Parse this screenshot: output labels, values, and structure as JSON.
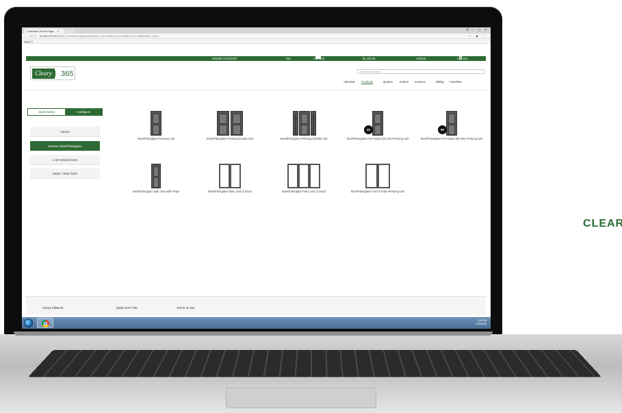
{
  "browser": {
    "tab_title": "Customer Home Page",
    "tab_close": "×",
    "window_buttons": "A – ◻ ✕",
    "url_host": "75.144.175.50",
    "url_path": ":8484/?_session=ptguyzireyholeib_seq=50026_ctl_id=925578_id=486906926_asm=",
    "nav_controls": "← → C ⓘ",
    "extensions": "☆ ▣ ⋮",
    "bookmarks": "Apps G"
  },
  "site": {
    "topbar": {
      "house_account": "HOUSE ACCOUNT",
      "net": "Net",
      "cart": "Cart (12)",
      "total": "$1,102.40",
      "user": "Andrew",
      "logout": "Log Out"
    },
    "logo": {
      "text1": "Cleary",
      "text2": "365"
    },
    "search": {
      "placeholder": "Search Keyword..."
    },
    "nav": [
      {
        "label": "Administ"
      },
      {
        "label": "Products"
      },
      {
        "label": "Quotes"
      },
      {
        "label": "Orders"
      },
      {
        "label": "Invoices"
      },
      {
        "label": "Billing"
      },
      {
        "label": "Favorites"
      }
    ],
    "toggle": {
      "stock": "Stock Items",
      "configure": "Configure"
    },
    "categories": [
      {
        "label": "Interior"
      },
      {
        "label": "Exterior Steel/Fiberglass"
      },
      {
        "label": "1-3/4 Wood Doors"
      },
      {
        "label": "Stairs / Stair Parts"
      }
    ],
    "products": [
      {
        "label": "Steel/Fiberglass Prehung Unit"
      },
      {
        "label": "Steel/Fiberglass Prehung Double Unit"
      },
      {
        "label": "Steel/Fiberglass Prehung Sidelite Unit"
      },
      {
        "label": "Steel/Fiberglass Fire Rated (20 Min) Prehung Unit",
        "badge": "20"
      },
      {
        "label": "Steel/Fiberglass Fire Rated (90 Min) Prehung Unit",
        "badge": "90"
      },
      {
        "label": "Steel/Fiberglass Slab Only with Preps"
      },
      {
        "label": "Steel/Fiberglass Patio Unit (2 Door)"
      },
      {
        "label": "Steel/Fiberglass Patio Unit (3 Door)"
      },
      {
        "label": "Steel/Fiberglass French Patio Prehung Unit"
      }
    ],
    "footer": {
      "company": "Cleary Millwork",
      "phone": "(508) 324-7700",
      "terms": "Terms of Use"
    }
  },
  "taskbar": {
    "time": "2:46 PM",
    "date": "1/25/2018"
  },
  "brand_text": "CLEAR",
  "colors": {
    "brand_green": "#2e6b34"
  }
}
